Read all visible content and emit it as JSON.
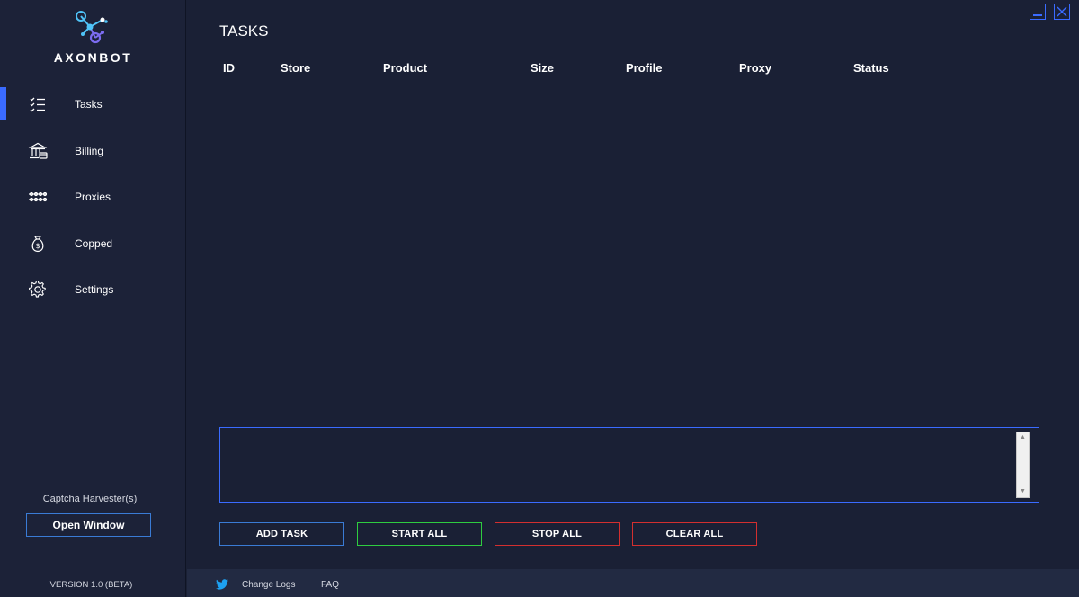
{
  "brand": {
    "name": "AXONBOT"
  },
  "sidebar": {
    "items": [
      {
        "label": "Tasks",
        "icon": "task-list-icon",
        "active": true
      },
      {
        "label": "Billing",
        "icon": "bank-icon"
      },
      {
        "label": "Proxies",
        "icon": "network-icon"
      },
      {
        "label": "Copped",
        "icon": "money-bag-icon"
      },
      {
        "label": "Settings",
        "icon": "gear-icon"
      }
    ],
    "captcha_label": "Captcha Harvester(s)",
    "open_window_label": "Open Window",
    "version": "VERSION 1.0 (BETA)"
  },
  "main": {
    "title": "TASKS",
    "columns": [
      "ID",
      "Store",
      "Product",
      "Size",
      "Profile",
      "Proxy",
      "Status"
    ],
    "rows": [],
    "log_text": ""
  },
  "actions": {
    "add_task": "ADD TASK",
    "start_all": "START ALL",
    "stop_all": "STOP ALL",
    "clear_all": "CLEAR ALL"
  },
  "footer": {
    "change_logs": "Change Logs",
    "faq": "FAQ"
  },
  "colors": {
    "accent": "#3a6bff",
    "add": "#3a7bd5",
    "start": "#2ecc40",
    "stop": "#d32f2f",
    "clear": "#d32f2f"
  }
}
